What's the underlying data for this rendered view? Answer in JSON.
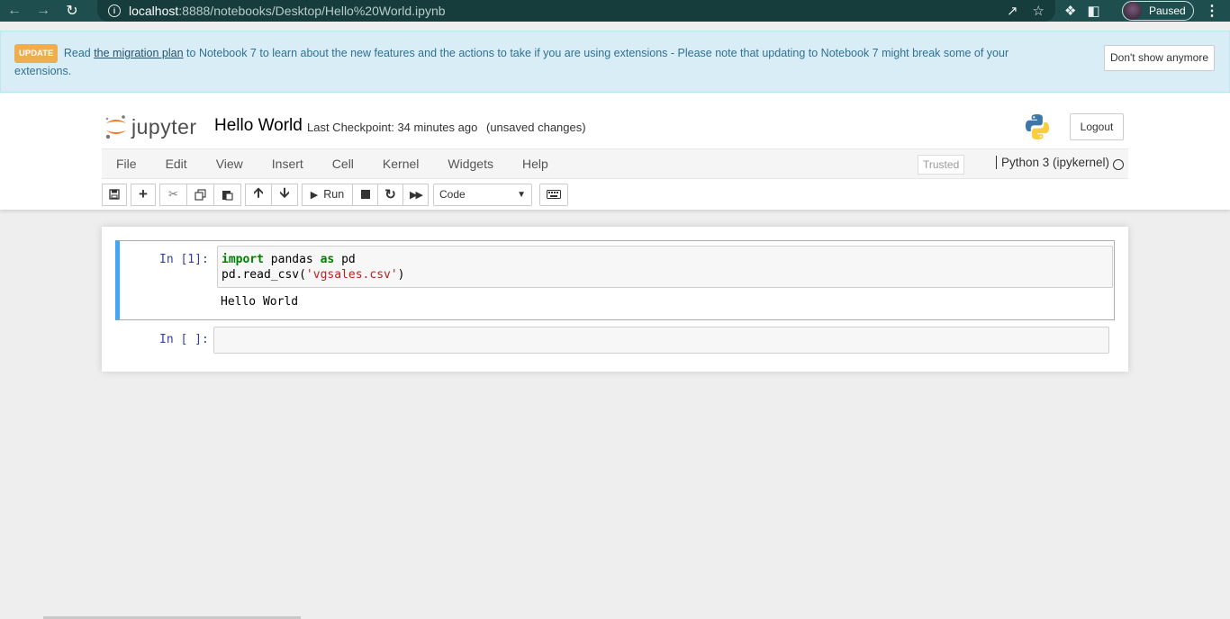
{
  "browser": {
    "url_host": "localhost",
    "url_path": ":8888/notebooks/Desktop/Hello%20World.ipynb",
    "profile_status": "Paused"
  },
  "banner": {
    "label": "UPDATE",
    "text_before": "Read ",
    "link_text": "the migration plan",
    "text_after": " to Notebook 7 to learn about the new features and the actions to take if you are using extensions - Please note that updating to Notebook 7 might break some of your extensions.",
    "dismiss_label": "Don't show anymore"
  },
  "header": {
    "logo_text": "jupyter",
    "notebook_name": "Hello World",
    "checkpoint": "Last Checkpoint: 34 minutes ago",
    "unsaved": "(unsaved changes)",
    "logout_label": "Logout"
  },
  "menu": {
    "items": [
      "File",
      "Edit",
      "View",
      "Insert",
      "Cell",
      "Kernel",
      "Widgets",
      "Help"
    ],
    "trusted": "Trusted",
    "kernel": "Python 3 (ipykernel)"
  },
  "toolbar": {
    "run_label": "Run",
    "cell_type": "Code"
  },
  "cells": [
    {
      "prompt": "In [1]:",
      "code_line1_kw": "import",
      "code_line1_mid": " pandas ",
      "code_line1_kw2": "as",
      "code_line1_end": " pd",
      "code_line2_start": "pd.read_csv(",
      "code_line2_str": "'vgsales.csv'",
      "code_line2_end": ")",
      "output": "Hello World"
    },
    {
      "prompt": "In [ ]:"
    }
  ],
  "colors": {
    "chrome": "#1f4e4e",
    "selected_cell": "#42a5f5",
    "banner_bg": "#d9edf7",
    "jupyter_orange": "#f37726"
  }
}
